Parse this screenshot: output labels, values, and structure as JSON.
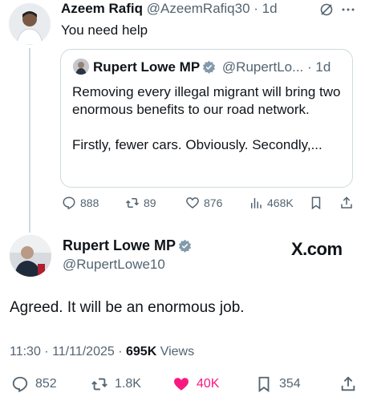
{
  "reply": {
    "author_name": "Azeem Rafiq",
    "author_handle": "@AzeemRafiq30",
    "time": "· 1d",
    "text": "You need help"
  },
  "quoted": {
    "author_name": "Rupert Lowe MP",
    "author_handle": "@RupertLo...",
    "time": "· 1d",
    "paragraph_1": "Removing every illegal migrant will bring two enormous benefits to our road network.",
    "paragraph_2": "Firstly, fewer cars. Obviously. Secondly,..."
  },
  "reply_actions": {
    "replies": "888",
    "reposts": "89",
    "likes": "876",
    "views": "468K"
  },
  "main": {
    "author_name": "Rupert Lowe MP",
    "author_handle": "@RupertLowe10",
    "watermark": "X.com",
    "text": "Agreed. It will be an enormous job.",
    "timestamp": "11:30 · 11/11/2025 ·",
    "views_count": "695K",
    "views_label": "Views"
  },
  "main_actions": {
    "replies": "852",
    "reposts": "1.8K",
    "likes": "40K",
    "bookmarks": "354"
  },
  "colors": {
    "verified": "#829aab",
    "like_active": "#f91880",
    "muted": "#536471"
  }
}
